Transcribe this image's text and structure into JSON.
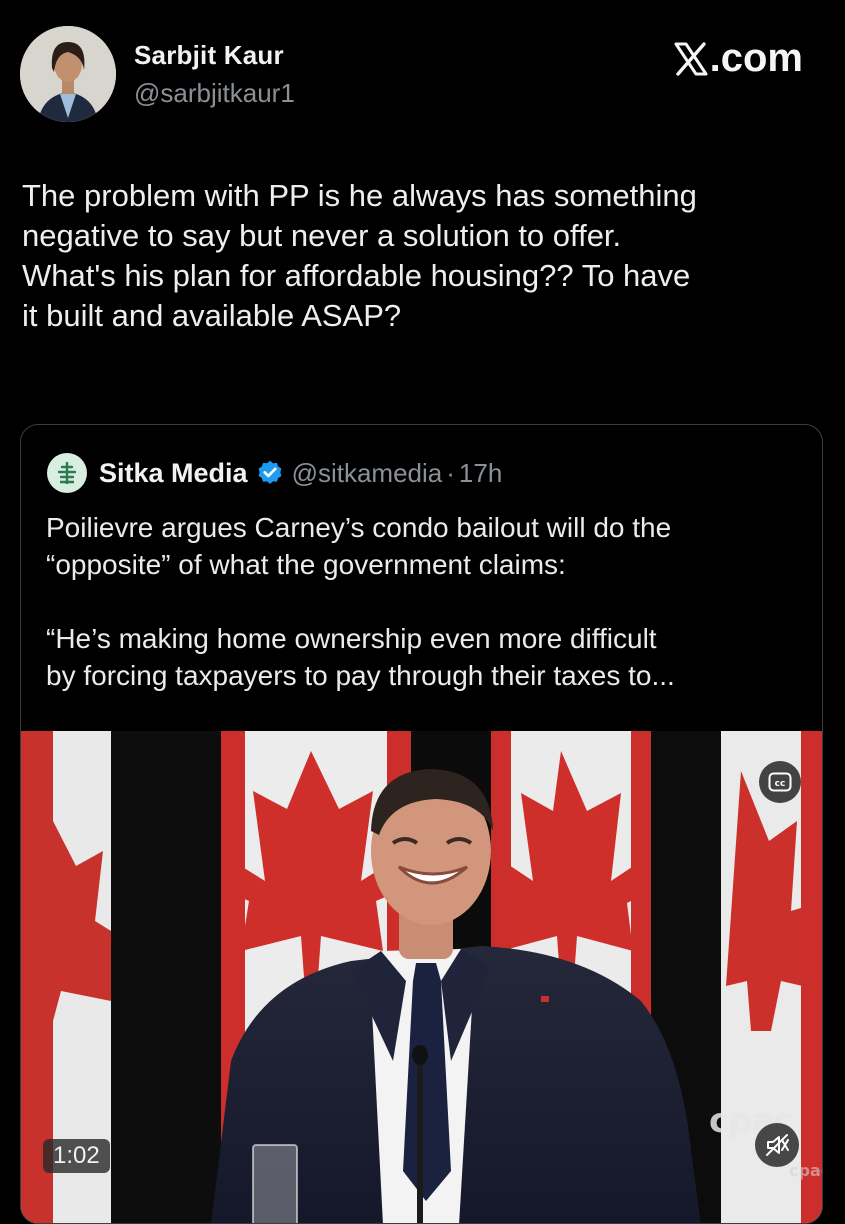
{
  "post": {
    "author_name": "Sarbjit Kaur",
    "author_handle": "@sarbjitkaur1",
    "site": "X.com",
    "text": "The problem with PP is he always has something\nnegative to say but never a solution to offer.\nWhat's his plan for affordable housing?? To have\nit built and available ASAP?"
  },
  "quoted_post": {
    "author_name": "Sitka Media",
    "verified": true,
    "author_handle": "@sitkamedia",
    "separator": "·",
    "time": "17h",
    "text": "Poilievre argues Carney’s condo bailout will do the\n“opposite” of what the government claims:\n\n“He’s making home ownership even more difficult\nby forcing taxpayers to pay through their taxes to...",
    "media": {
      "type": "video",
      "duration": "1:02",
      "watermark": "cpac",
      "watermark_small": "cpac",
      "controls": [
        "cc-icon",
        "mute-icon"
      ]
    }
  },
  "colors": {
    "background": "#000000",
    "text": "#e7e9ea",
    "secondary_text": "#8b9096",
    "verified": "#1d9bf0",
    "border": "#3a3d41"
  }
}
